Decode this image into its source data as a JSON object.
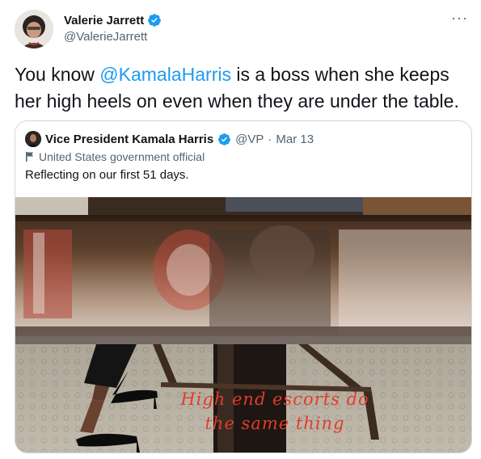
{
  "author": {
    "display_name": "Valerie Jarrett",
    "handle": "@ValerieJarrett",
    "verified": true,
    "avatar_icon": "profile-photo"
  },
  "more_label": "···",
  "tweet": {
    "text_before": "You know ",
    "mention": "@KamalaHarris",
    "text_after": " is a boss when she keeps her high heels on even when they are under the table."
  },
  "quoted": {
    "display_name": "Vice President Kamala Harris",
    "handle": "@VP",
    "separator": "·",
    "date": "Mar 13",
    "label": "United States government official",
    "text": "Reflecting on our first 51 days.",
    "photo_overlay_line1": "High end escorts do",
    "photo_overlay_line2": "the same thing"
  },
  "colors": {
    "link": "#1d9bf0",
    "verified": "#1d9bf0",
    "secondary_text": "#536471",
    "overlay_text": "#e23b2a"
  }
}
